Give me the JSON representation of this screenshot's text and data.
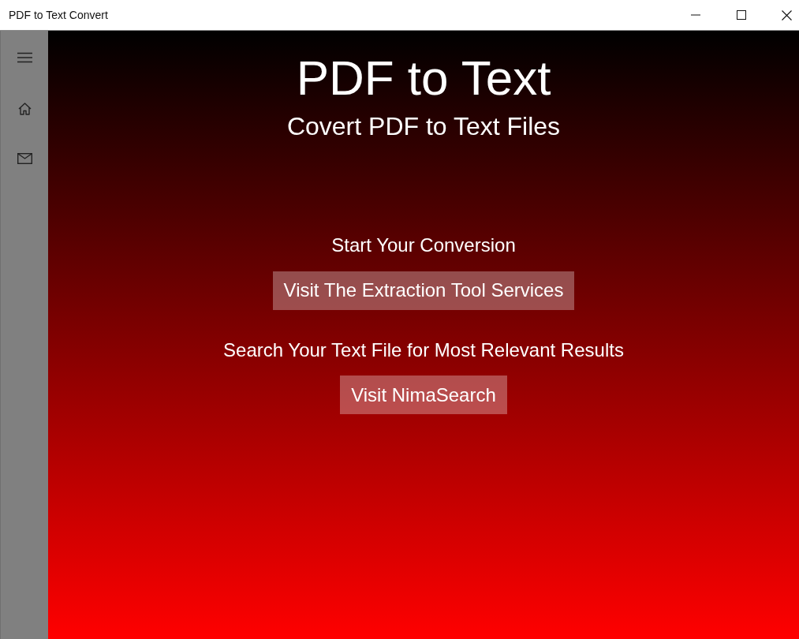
{
  "window": {
    "title": "PDF to Text Convert"
  },
  "main": {
    "heading": "PDF to Text",
    "subheading": "Covert PDF to Text Files",
    "sections": [
      {
        "label": "Start Your Conversion",
        "button": "Visit The Extraction Tool Services"
      },
      {
        "label": "Search Your Text File for Most Relevant Results",
        "button": "Visit NimaSearch"
      }
    ]
  }
}
